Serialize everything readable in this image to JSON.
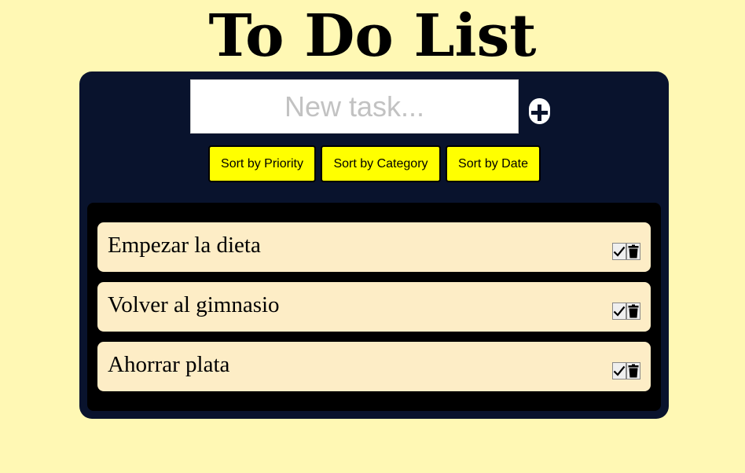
{
  "header": {
    "title": "To Do List"
  },
  "new_task": {
    "placeholder": "New task...",
    "value": "",
    "add_icon": "plus-circle-icon"
  },
  "sort_buttons": [
    {
      "label": "Sort by Priority"
    },
    {
      "label": "Sort by Category"
    },
    {
      "label": "Sort by Date"
    }
  ],
  "tasks": [
    {
      "text": "Empezar la dieta",
      "complete_icon": "checkmark-icon",
      "delete_icon": "trash-icon"
    },
    {
      "text": "Volver al gimnasio",
      "complete_icon": "checkmark-icon",
      "delete_icon": "trash-icon"
    },
    {
      "text": "Ahorrar plata",
      "complete_icon": "checkmark-icon",
      "delete_icon": "trash-icon"
    }
  ],
  "colors": {
    "page_background": "#fff8b4",
    "panel_background": "#09132d",
    "list_background": "#000000",
    "task_background": "#fdedc6",
    "sort_button_background": "#ffff00"
  }
}
